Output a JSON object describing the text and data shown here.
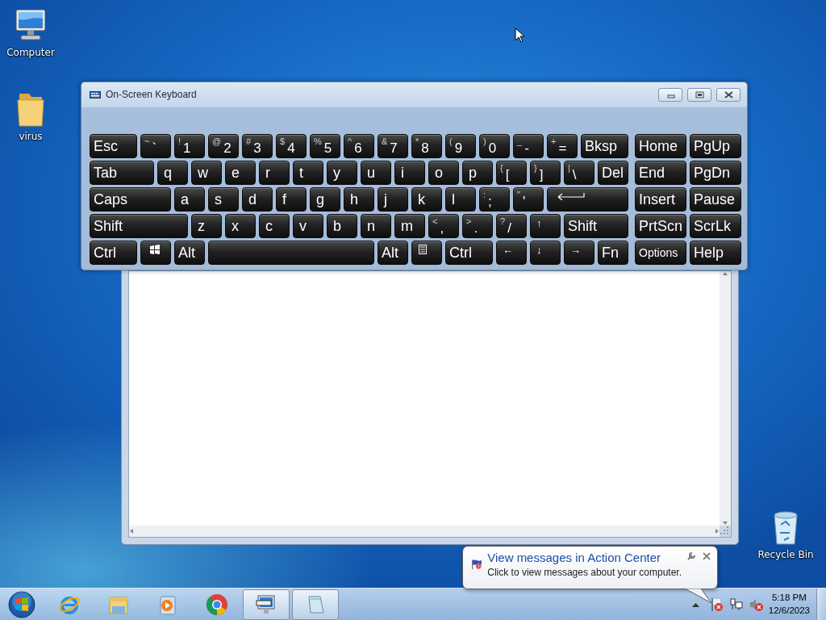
{
  "desktop_icons": [
    {
      "kind": "computer",
      "label": "Computer"
    },
    {
      "kind": "folder",
      "label": "virus"
    },
    {
      "kind": "recycle",
      "label": "Recycle Bin"
    }
  ],
  "keyboard_window": {
    "title": "On-Screen Keyboard",
    "rows": [
      {
        "keys": [
          {
            "kind": "text",
            "main": "Esc"
          },
          {
            "kind": "char",
            "shift": "~",
            "main": "`"
          },
          {
            "kind": "char",
            "shift": "!",
            "main": "1"
          },
          {
            "kind": "char",
            "shift": "@",
            "main": "2"
          },
          {
            "kind": "char",
            "shift": "#",
            "main": "3"
          },
          {
            "kind": "char",
            "shift": "$",
            "main": "4"
          },
          {
            "kind": "char",
            "shift": "%",
            "main": "5"
          },
          {
            "kind": "char",
            "shift": "^",
            "main": "6"
          },
          {
            "kind": "char",
            "shift": "&",
            "main": "7"
          },
          {
            "kind": "char",
            "shift": "*",
            "main": "8"
          },
          {
            "kind": "char",
            "shift": "(",
            "main": "9"
          },
          {
            "kind": "char",
            "shift": ")",
            "main": "0"
          },
          {
            "kind": "char",
            "shift": "_",
            "main": "-"
          },
          {
            "kind": "char",
            "shift": "+",
            "main": "="
          },
          {
            "kind": "text",
            "main": "Bksp"
          }
        ],
        "nav": [
          {
            "kind": "text",
            "main": "Home"
          },
          {
            "kind": "text",
            "main": "PgUp"
          }
        ]
      },
      {
        "keys": [
          {
            "kind": "text",
            "main": "Tab"
          },
          {
            "kind": "letter",
            "main": "q"
          },
          {
            "kind": "letter",
            "main": "w"
          },
          {
            "kind": "letter",
            "main": "e"
          },
          {
            "kind": "letter",
            "main": "r"
          },
          {
            "kind": "letter",
            "main": "t"
          },
          {
            "kind": "letter",
            "main": "y"
          },
          {
            "kind": "letter",
            "main": "u"
          },
          {
            "kind": "letter",
            "main": "i"
          },
          {
            "kind": "letter",
            "main": "o"
          },
          {
            "kind": "letter",
            "main": "p"
          },
          {
            "kind": "char",
            "shift": "{",
            "main": "["
          },
          {
            "kind": "char",
            "shift": "}",
            "main": "]"
          },
          {
            "kind": "char",
            "shift": "|",
            "main": "\\"
          },
          {
            "kind": "text",
            "main": "Del"
          }
        ],
        "nav": [
          {
            "kind": "text",
            "main": "End"
          },
          {
            "kind": "text",
            "main": "PgDn"
          }
        ]
      },
      {
        "keys": [
          {
            "kind": "text",
            "main": "Caps"
          },
          {
            "kind": "letter",
            "main": "a"
          },
          {
            "kind": "letter",
            "main": "s"
          },
          {
            "kind": "letter",
            "main": "d"
          },
          {
            "kind": "letter",
            "main": "f"
          },
          {
            "kind": "letter",
            "main": "g"
          },
          {
            "kind": "letter",
            "main": "h"
          },
          {
            "kind": "letter",
            "main": "j"
          },
          {
            "kind": "letter",
            "main": "k"
          },
          {
            "kind": "letter",
            "main": "l"
          },
          {
            "kind": "char",
            "shift": ":",
            "main": ";"
          },
          {
            "kind": "char",
            "shift": "\"",
            "main": "'"
          },
          {
            "kind": "enter"
          }
        ],
        "nav": [
          {
            "kind": "text",
            "main": "Insert"
          },
          {
            "kind": "text",
            "main": "Pause"
          }
        ]
      },
      {
        "keys": [
          {
            "kind": "text",
            "main": "Shift"
          },
          {
            "kind": "letter",
            "main": "z"
          },
          {
            "kind": "letter",
            "main": "x"
          },
          {
            "kind": "letter",
            "main": "c"
          },
          {
            "kind": "letter",
            "main": "v"
          },
          {
            "kind": "letter",
            "main": "b"
          },
          {
            "kind": "letter",
            "main": "n"
          },
          {
            "kind": "letter",
            "main": "m"
          },
          {
            "kind": "char",
            "shift": "<",
            "main": ","
          },
          {
            "kind": "char",
            "shift": ">",
            "main": "."
          },
          {
            "kind": "char",
            "shift": "?",
            "main": "/"
          },
          {
            "kind": "arrow",
            "main": "↑"
          },
          {
            "kind": "text",
            "main": "Shift"
          }
        ],
        "nav": [
          {
            "kind": "text",
            "main": "PrtScn"
          },
          {
            "kind": "text",
            "main": "ScrLk"
          }
        ]
      },
      {
        "keys": [
          {
            "kind": "text",
            "main": "Ctrl"
          },
          {
            "kind": "windows"
          },
          {
            "kind": "text",
            "main": "Alt"
          },
          {
            "kind": "space"
          },
          {
            "kind": "text",
            "main": "Alt"
          },
          {
            "kind": "menu"
          },
          {
            "kind": "text",
            "main": "Ctrl"
          },
          {
            "kind": "arrow",
            "main": "←"
          },
          {
            "kind": "arrow",
            "main": "↓"
          },
          {
            "kind": "arrow",
            "main": "→"
          },
          {
            "kind": "text",
            "main": "Fn"
          }
        ],
        "nav": [
          {
            "kind": "small",
            "main": "Options"
          },
          {
            "kind": "text",
            "main": "Help"
          }
        ]
      }
    ]
  },
  "notification": {
    "title": "View messages in Action Center",
    "message": "Click to view messages about your computer."
  },
  "taskbar": {
    "apps": [
      {
        "kind": "ie",
        "open": false
      },
      {
        "kind": "explorer",
        "open": false
      },
      {
        "kind": "media",
        "open": false
      },
      {
        "kind": "chrome",
        "open": false
      },
      {
        "kind": "keyboard",
        "open": true
      },
      {
        "kind": "notepad",
        "open": true
      }
    ],
    "clock_time": "5:18 PM",
    "clock_date": "12/6/2023"
  }
}
